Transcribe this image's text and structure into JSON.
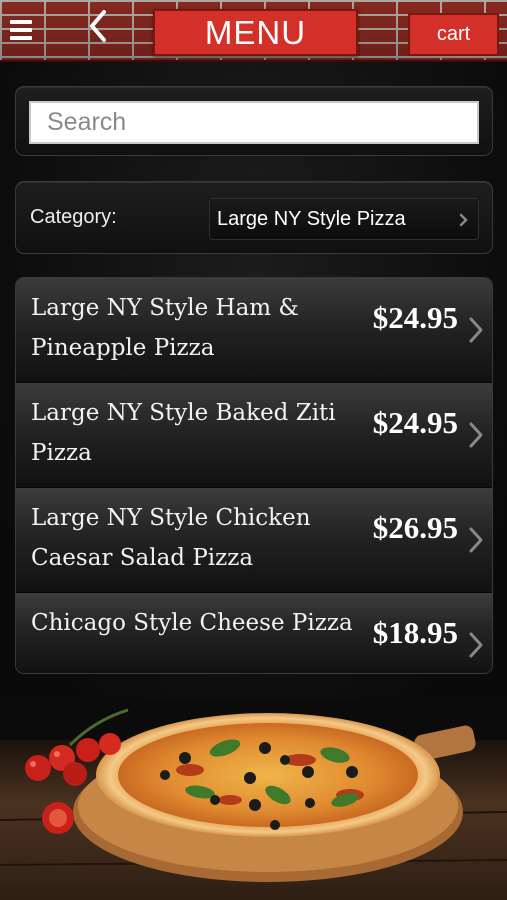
{
  "header": {
    "title": "MENU",
    "cart_label": "cart"
  },
  "search": {
    "placeholder": "Search",
    "value": ""
  },
  "category": {
    "label": "Category:",
    "selected": "Large NY Style Pizza"
  },
  "items": [
    {
      "name": "Large NY Style Ham & Pineapple Pizza",
      "price": "$24.95"
    },
    {
      "name": "Large NY Style Baked Ziti Pizza",
      "price": "$24.95"
    },
    {
      "name": "Large NY Style Chicken Caesar Salad Pizza",
      "price": "$26.95"
    },
    {
      "name": "Chicago Style Cheese Pizza",
      "price": "$18.95"
    }
  ],
  "colors": {
    "accent": "#d3302a",
    "brick": "#8e2b22",
    "background": "#0b0b0b",
    "text": "#ffffff"
  },
  "icons": [
    "hamburger-icon",
    "back-chevron-icon",
    "chevron-right-icon"
  ]
}
